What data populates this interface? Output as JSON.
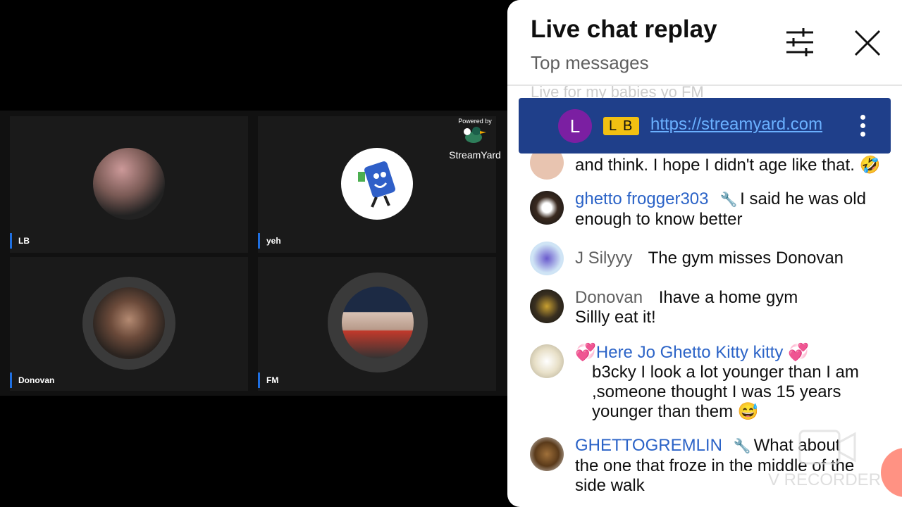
{
  "video": {
    "powered_by": "Powered by",
    "brand": "StreamYard",
    "participants": [
      {
        "name": "LB"
      },
      {
        "name": "yeh"
      },
      {
        "name": "Donovan"
      },
      {
        "name": "FM"
      }
    ]
  },
  "chat": {
    "title": "Live chat replay",
    "subtitle": "Top messages",
    "faded_row": "Live for my babies    yo FM",
    "pinned": {
      "avatar_letter": "L",
      "badge": "L B",
      "link": "https://streamyard.com"
    },
    "messages": [
      {
        "author": "",
        "text": "and think. I hope I didn't age like that. 🤣"
      },
      {
        "author": "ghetto frogger303",
        "member": true,
        "text": "I said he was old enough to know better"
      },
      {
        "author": "J Silyyy",
        "member": false,
        "text": "The gym misses Donovan"
      },
      {
        "author": "Donovan",
        "member": false,
        "text": "Ihave a home gym Sillly eat it!"
      },
      {
        "author": "💞Here Jo Ghetto Kitty kitty 💞",
        "member": true,
        "text": "b3cky I look a lot younger than I am ,someone thought I was 15 years younger than them 😅"
      },
      {
        "author": "GHETTOGREMLIN",
        "member": true,
        "text": "What about the one that froze in the middle of the side walk"
      }
    ]
  },
  "watermark": "V RECORDER"
}
